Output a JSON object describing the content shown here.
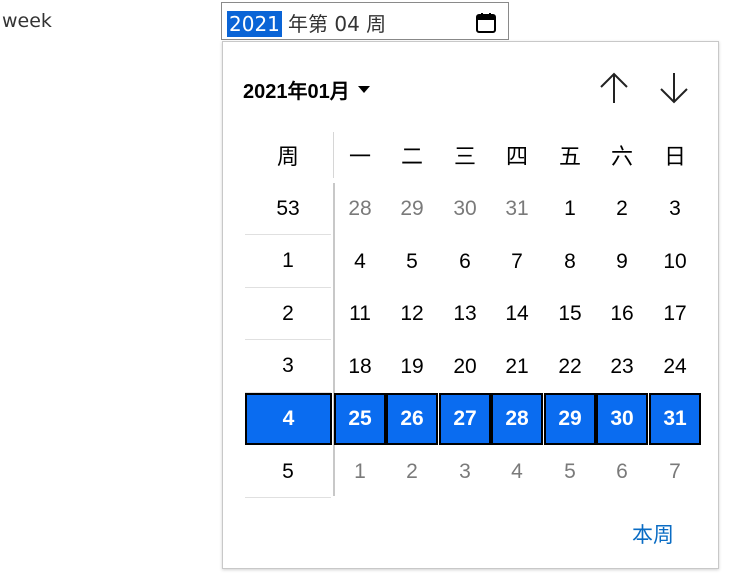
{
  "field": {
    "label": "week",
    "year": "2021",
    "rest": "年第 04 周",
    "calendar_icon": "calendar-icon"
  },
  "picker": {
    "month_label": "2021年01月",
    "prev_icon": "arrow-up-icon",
    "next_icon": "arrow-down-icon",
    "week_header": "周",
    "day_headers": [
      "一",
      "二",
      "三",
      "四",
      "五",
      "六",
      "日"
    ],
    "rows": [
      {
        "week": "53",
        "days": [
          "28",
          "29",
          "30",
          "31",
          "1",
          "2",
          "3"
        ],
        "other": [
          true,
          true,
          true,
          true,
          false,
          false,
          false
        ],
        "selected": false
      },
      {
        "week": "1",
        "days": [
          "4",
          "5",
          "6",
          "7",
          "8",
          "9",
          "10"
        ],
        "other": [
          false,
          false,
          false,
          false,
          false,
          false,
          false
        ],
        "selected": false
      },
      {
        "week": "2",
        "days": [
          "11",
          "12",
          "13",
          "14",
          "15",
          "16",
          "17"
        ],
        "other": [
          false,
          false,
          false,
          false,
          false,
          false,
          false
        ],
        "selected": false
      },
      {
        "week": "3",
        "days": [
          "18",
          "19",
          "20",
          "21",
          "22",
          "23",
          "24"
        ],
        "other": [
          false,
          false,
          false,
          false,
          false,
          false,
          false
        ],
        "selected": false
      },
      {
        "week": "4",
        "days": [
          "25",
          "26",
          "27",
          "28",
          "29",
          "30",
          "31"
        ],
        "other": [
          false,
          false,
          false,
          false,
          false,
          false,
          false
        ],
        "selected": true
      },
      {
        "week": "5",
        "days": [
          "1",
          "2",
          "3",
          "4",
          "5",
          "6",
          "7"
        ],
        "other": [
          true,
          true,
          true,
          true,
          true,
          true,
          true
        ],
        "selected": false
      }
    ],
    "this_week": "本周"
  },
  "colors": {
    "selection": "#0a6cf0",
    "year_highlight": "#0a64d6",
    "link": "#0a6cc4",
    "muted_day": "#7a7a7a"
  }
}
